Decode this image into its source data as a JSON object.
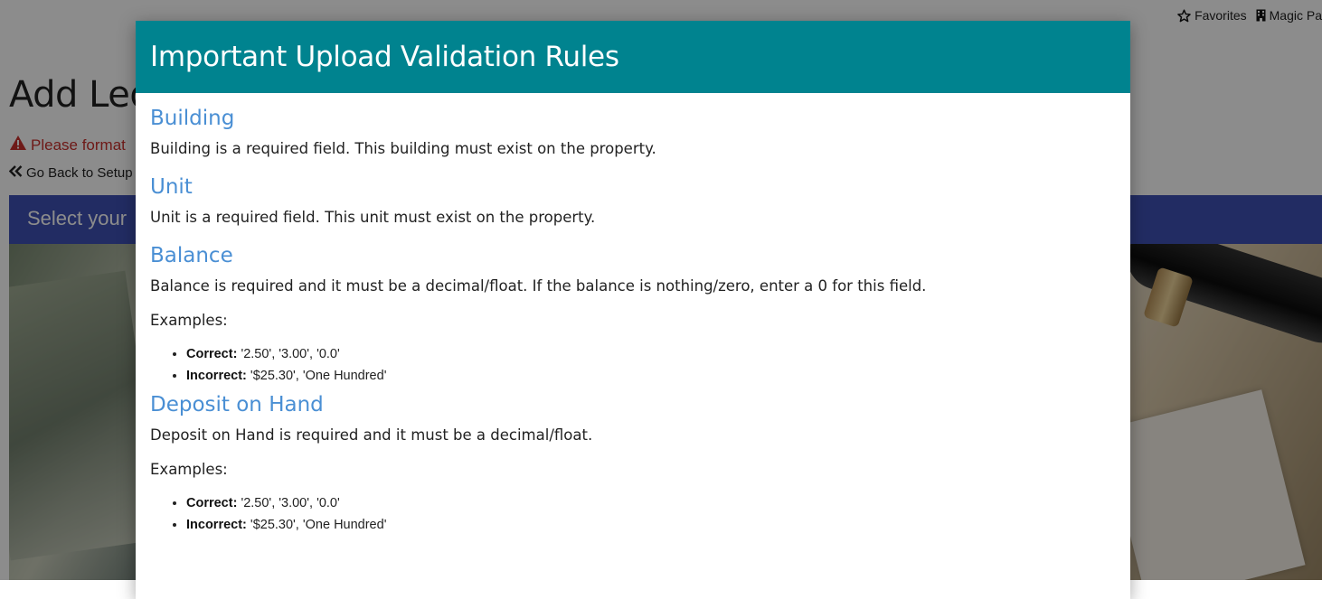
{
  "nav": {
    "favorites_label": "Favorites",
    "magic_label": "Magic Pa"
  },
  "page": {
    "title": "Add Led",
    "warning_text": "Please format",
    "back_label": "Go Back to Setup",
    "select_label": "Select your"
  },
  "modal": {
    "title": "Important Upload Validation Rules",
    "rules": [
      {
        "heading": "Building",
        "description": "Building is a required field. This building must exist on the property."
      },
      {
        "heading": "Unit",
        "description": "Unit is a required field. This unit must exist on the property."
      },
      {
        "heading": "Balance",
        "description": "Balance is required and it must be a decimal/float. If the balance is nothing/zero, enter a 0 for this field.",
        "examples_label": "Examples:",
        "correct_label": "Correct:",
        "correct_values": "'2.50', '3.00', '0.0'",
        "incorrect_label": "Incorrect:",
        "incorrect_values": "'$25.30', 'One Hundred'"
      },
      {
        "heading": "Deposit on Hand",
        "description": "Deposit on Hand is required and it must be a decimal/float.",
        "examples_label": "Examples:",
        "correct_label": "Correct:",
        "correct_values": "'2.50', '3.00', '0.0'",
        "incorrect_label": "Incorrect:",
        "incorrect_values": "'$25.30', 'One Hundred'"
      }
    ]
  },
  "colors": {
    "modal_header": "#00838f",
    "heading_blue": "#4a8fd4",
    "warning_red": "#c9302c",
    "select_bar": "#3f51b5"
  },
  "icons": [
    "star-icon",
    "building-icon",
    "warning-icon",
    "double-chevron-left-icon"
  ]
}
